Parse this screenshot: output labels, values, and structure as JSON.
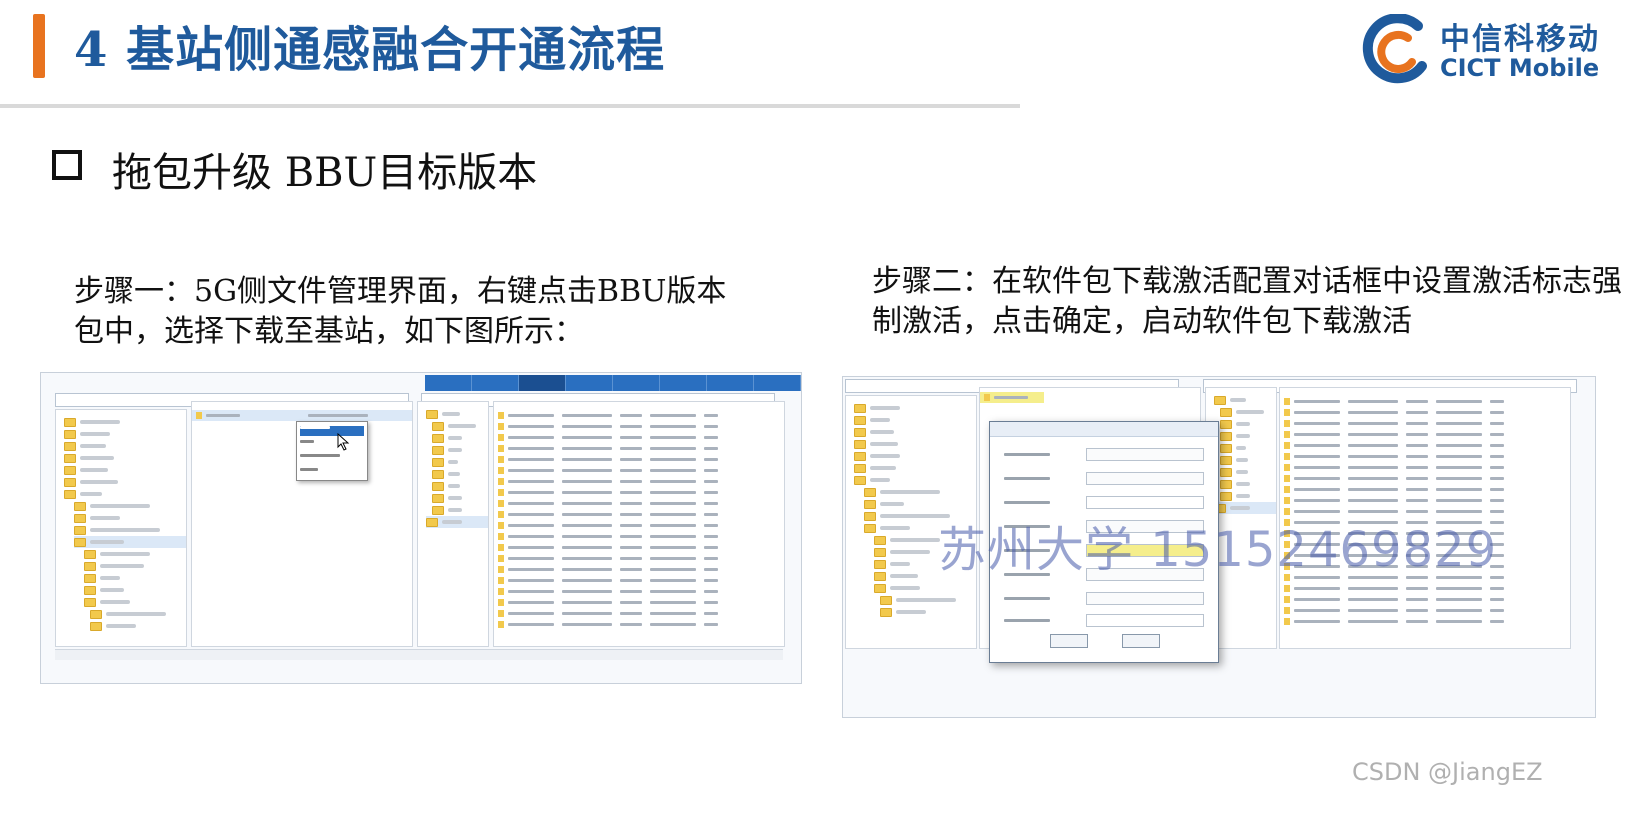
{
  "header": {
    "title": "4 基站侧通感融合开通流程",
    "logo_cn": "中信科移动",
    "logo_en": "CICT Mobile"
  },
  "section": {
    "subtitle": "拖包升级 BBU目标版本"
  },
  "steps": {
    "step1": "步骤一：5G侧文件管理界面，右键点击BBU版本包中，选择下载至基站，如下图所示：",
    "step2": "步骤二：在软件包下载激活配置对话框中设置激活标志强制激活，点击确定，启动软件包下载激活"
  },
  "overlay": {
    "watermark": "苏州大学 15152469829",
    "source_mark": "CSDN @JiangEZ"
  },
  "colors": {
    "title": "#1f5a9c",
    "accent": "#e8731f",
    "tabbar": "#2a6fc0"
  }
}
